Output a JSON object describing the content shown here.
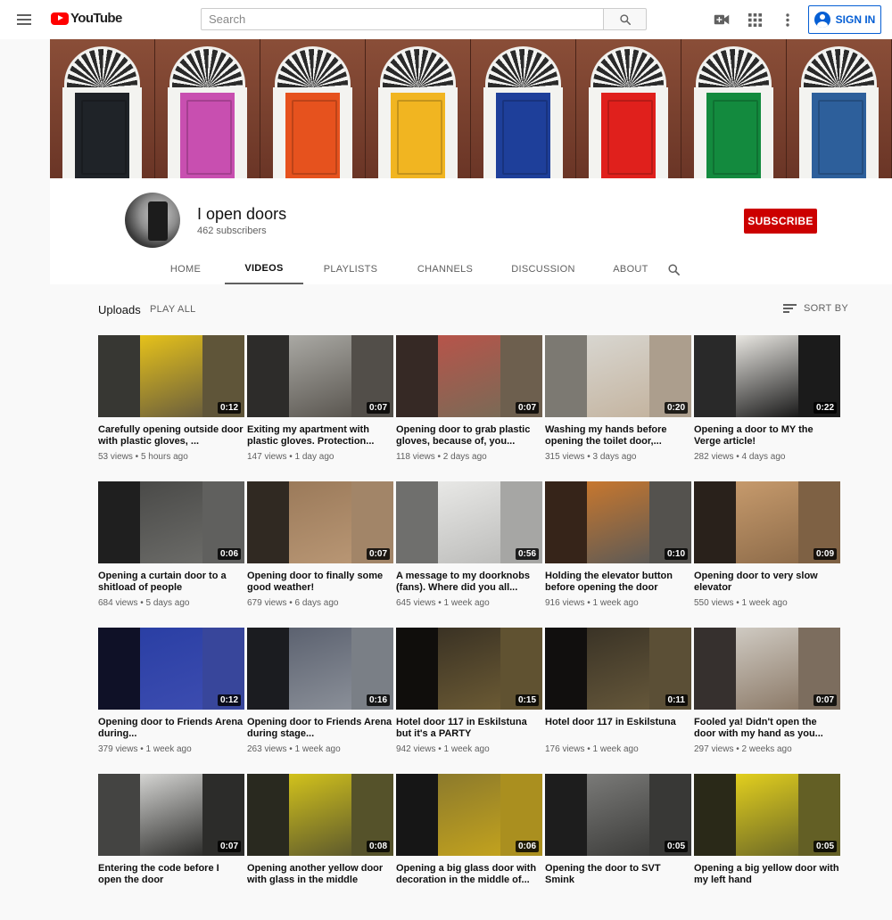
{
  "header": {
    "logo_text": "YouTube",
    "search_placeholder": "Search",
    "sign_in_label": "SIGN IN"
  },
  "banner": {
    "door_colors": [
      "#1f2328",
      "#c84fb0",
      "#e6521e",
      "#f1b521",
      "#1e3f9a",
      "#e0201c",
      "#138a3e",
      "#2d5f9b"
    ]
  },
  "channel": {
    "name": "I open doors",
    "subscribers": "462 subscribers",
    "subscribe_label": "SUBSCRIBE",
    "tabs": [
      {
        "label": "HOME"
      },
      {
        "label": "VIDEOS"
      },
      {
        "label": "PLAYLISTS"
      },
      {
        "label": "CHANNELS"
      },
      {
        "label": "DISCUSSION"
      },
      {
        "label": "ABOUT"
      }
    ],
    "active_tab": "VIDEOS"
  },
  "uploads": {
    "title": "Uploads",
    "play_all": "PLAY ALL",
    "sort_by": "SORT BY"
  },
  "videos": [
    {
      "title": "Carefully opening outside door with plastic gloves, ...",
      "views": "53 views",
      "age": "5 hours ago",
      "duration": "0:12",
      "colors": [
        "#e6c21a",
        "#3b3b36",
        "#6a5e3d"
      ]
    },
    {
      "title": "Exiting my apartment with plastic gloves. Protection...",
      "views": "147 views",
      "age": "1 day ago",
      "duration": "0:07",
      "colors": [
        "#aaa9a4",
        "#2f2e2c",
        "#5a5650"
      ]
    },
    {
      "title": "Opening door to grab plastic gloves, because of, you...",
      "views": "118 views",
      "age": "2 days ago",
      "duration": "0:07",
      "colors": [
        "#b7544a",
        "#3a2a26",
        "#7a6a56"
      ]
    },
    {
      "title": "Washing my hands before opening the toilet door,...",
      "views": "315 views",
      "age": "3 days ago",
      "duration": "0:20",
      "colors": [
        "#d8d6d0",
        "#8c8880",
        "#c4b4a0"
      ]
    },
    {
      "title": "Opening a door to MY the Verge article!",
      "views": "282 views",
      "age": "4 days ago",
      "duration": "0:22",
      "colors": [
        "#e9e7e2",
        "#2a2a2a",
        "#1a1a1a"
      ]
    },
    {
      "title": "Opening a curtain door to a shitload of people",
      "views": "684 views",
      "age": "5 days ago",
      "duration": "0:06",
      "colors": [
        "#4a4a48",
        "#1f1f1f",
        "#6b6b68"
      ]
    },
    {
      "title": "Opening door to finally some good weather!",
      "views": "679 views",
      "age": "6 days ago",
      "duration": "0:07",
      "colors": [
        "#9b7a5a",
        "#332a22",
        "#b89674"
      ]
    },
    {
      "title": "A message to my doorknobs (fans). Where did you all...",
      "views": "645 views",
      "age": "1 week ago",
      "duration": "0:56",
      "colors": [
        "#e8e8e6",
        "#7c7c7a",
        "#bdbdbb"
      ]
    },
    {
      "title": "Holding the elevator button before opening the door",
      "views": "916 views",
      "age": "1 week ago",
      "duration": "0:10",
      "colors": [
        "#c7772e",
        "#3a2418",
        "#5d5a56"
      ]
    },
    {
      "title": "Opening door to very slow elevator",
      "views": "550 views",
      "age": "1 week ago",
      "duration": "0:09",
      "colors": [
        "#c69a6c",
        "#2a211a",
        "#8e6c4a"
      ]
    },
    {
      "title": "Opening door to Friends Arena during...",
      "views": "379 views",
      "age": "1 week ago",
      "duration": "0:12",
      "colors": [
        "#2a3fa4",
        "#0c0e28",
        "#3c4cb0"
      ]
    },
    {
      "title": "Opening door to Friends Arena during stage...",
      "views": "263 views",
      "age": "1 week ago",
      "duration": "0:16",
      "colors": [
        "#5c6270",
        "#1a1b20",
        "#8a8f98"
      ]
    },
    {
      "title": "Hotel door 117 in Eskilstuna but it's a PARTY",
      "views": "942 views",
      "age": "1 week ago",
      "duration": "0:15",
      "colors": [
        "#3a3224",
        "#0d0b08",
        "#6b5a34"
      ]
    },
    {
      "title": "Hotel door 117 in Eskilstuna",
      "views": "176 views",
      "age": "1 week ago",
      "duration": "0:11",
      "colors": [
        "#3a3326",
        "#0e0c0a",
        "#65573a"
      ]
    },
    {
      "title": "Fooled ya! Didn't open the door with my hand as you...",
      "views": "297 views",
      "age": "2 weeks ago",
      "duration": "0:07",
      "colors": [
        "#cfcac2",
        "#3a3330",
        "#8c7a68"
      ]
    },
    {
      "title": "Entering the code before I open the door",
      "views": "",
      "age": "",
      "duration": "0:07",
      "colors": [
        "#d4d4d2",
        "#4a4a48",
        "#2e2e2c"
      ]
    },
    {
      "title": "Opening another yellow door with glass in the middle",
      "views": "",
      "age": "",
      "duration": "0:08",
      "colors": [
        "#d2c21c",
        "#2a2a1e",
        "#5e5a2c"
      ]
    },
    {
      "title": "Opening a big glass door with decoration in the middle of...",
      "views": "",
      "age": "",
      "duration": "0:06",
      "colors": [
        "#8c7a2c",
        "#141414",
        "#c2a21e"
      ]
    },
    {
      "title": "Opening the door to SVT Smink",
      "views": "",
      "age": "",
      "duration": "0:05",
      "colors": [
        "#7a7a78",
        "#1c1c1c",
        "#3c3c3a"
      ]
    },
    {
      "title": "Opening a big yellow door with my left hand",
      "views": "",
      "age": "",
      "duration": "0:05",
      "colors": [
        "#e2cf1e",
        "#2c2a16",
        "#6e6a26"
      ]
    }
  ]
}
